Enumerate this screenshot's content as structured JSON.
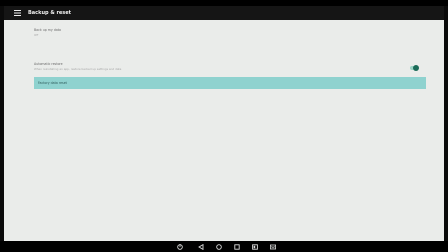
{
  "status_bar": {
    "left_text": "",
    "right_text": ""
  },
  "app_bar": {
    "menu_icon": "hamburger-menu-icon",
    "title": "Backup & reset"
  },
  "settings": {
    "backup": {
      "title": "Back up my data",
      "subtitle": "Off"
    },
    "backup_account": {
      "title": "",
      "subtitle": ""
    },
    "automatic_restore": {
      "title": "Automatic restore",
      "subtitle": "When reinstalling an app, restore backed up settings and data",
      "checked": true
    },
    "factory_reset": {
      "label": "Factory data reset"
    }
  },
  "nav_bar": {
    "buttons": [
      {
        "icon": "home-circle-icon"
      },
      {
        "icon": "back-icon"
      },
      {
        "icon": "home-icon"
      },
      {
        "icon": "recents-icon"
      },
      {
        "icon": "screenshot-icon"
      },
      {
        "icon": "keyboard-icon"
      }
    ]
  },
  "colors": {
    "accent": "#1b6b58",
    "highlight": "#8fd2cf",
    "app_bar": "#151515",
    "content_bg": "#eaecea"
  }
}
